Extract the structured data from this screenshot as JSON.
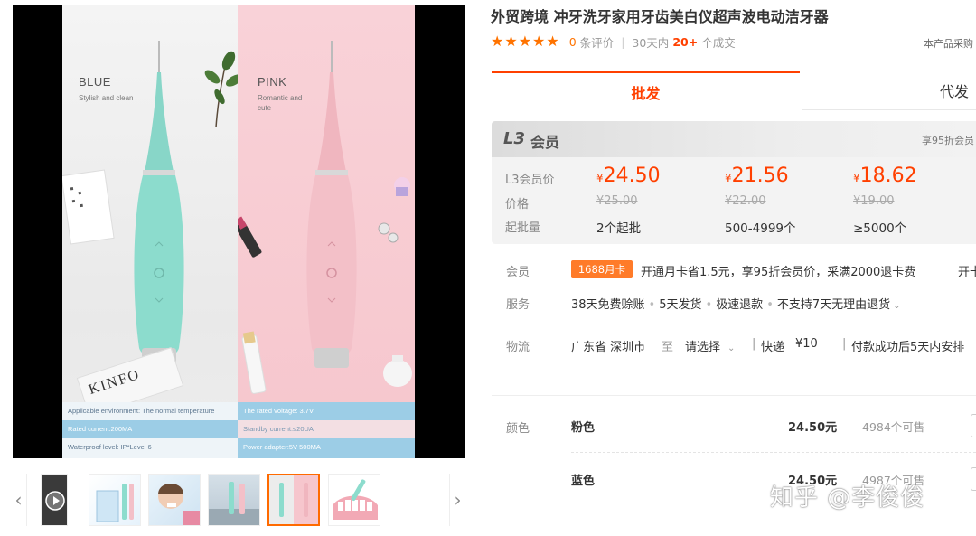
{
  "product": {
    "title": "外贸跨境 冲牙洗牙家用牙齿美白仪超声波电动洁牙器",
    "rating_count": "0",
    "rating_label": "条评价",
    "period": "30天内",
    "deals": "20+",
    "deals_label": "个成交",
    "procure_note": "本产品采购"
  },
  "gallery": {
    "blue_title": "BLUE",
    "blue_sub": "Stylish and clean",
    "pink_title": "PINK",
    "pink_sub": "Romantic and cute",
    "book_text": "KINFO",
    "specs_left": [
      "Applicable environment: The normal temperature",
      "Rated current:200MA",
      "Waterproof level: IP*Level 6"
    ],
    "specs_right": [
      "The rated voltage: 3.7V",
      "Standby current:≤20UA",
      "Power adapter:5V   500MA"
    ]
  },
  "tabs": {
    "wholesale": "批发",
    "dropship": "代发"
  },
  "member": {
    "level": "L3",
    "label": "会员",
    "discount_note": "享95折会员"
  },
  "pricing": {
    "currency": "¥",
    "row_member": "L3会员价",
    "row_price": "价格",
    "row_batch": "起批量",
    "tiers": [
      {
        "member_price": "24.50",
        "price": "¥25.00",
        "batch": "2个起批"
      },
      {
        "member_price": "21.56",
        "price": "¥22.00",
        "batch": "500-4999个"
      },
      {
        "member_price": "18.62",
        "price": "¥19.00",
        "batch": "≥5000个"
      }
    ]
  },
  "info": {
    "member_label": "会员",
    "card_badge": "1688月卡",
    "card_text": "开通月卡省1.5元，享95折会员价，采满2000退卡费",
    "card_action": "开卡",
    "service_label": "服务",
    "services": [
      "38天免费赊账",
      "5天发货",
      "极速退款",
      "不支持7天无理由退货"
    ],
    "logistics_label": "物流",
    "origin": "广东省 深圳市",
    "to": "至",
    "destination": "请选择",
    "express": "快递",
    "fee": "¥10",
    "ship_note": "付款成功后5天内安排"
  },
  "sku": {
    "color_label": "颜色",
    "items": [
      {
        "name": "粉色",
        "price": "24.50元",
        "stock": "4984个可售"
      },
      {
        "name": "蓝色",
        "price": "24.50元",
        "stock": "4987个可售"
      }
    ]
  },
  "watermark": "知乎 @李俊俊",
  "colors": {
    "accent": "#ff4000",
    "star": "#ff7300",
    "badge": "#ff7b29"
  }
}
